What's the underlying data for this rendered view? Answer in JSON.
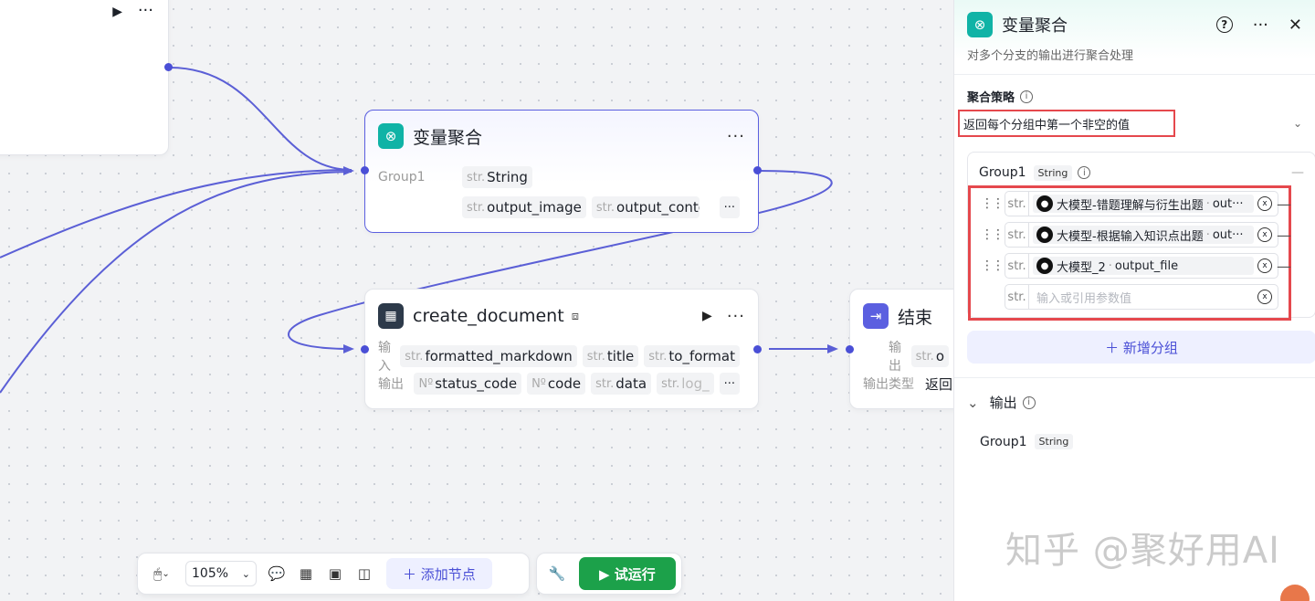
{
  "canvas": {
    "agg_node": {
      "title": "变量聚合",
      "more": "···",
      "group_label": "Group1",
      "type_chip": {
        "t": "str.",
        "v": "String"
      },
      "chips": [
        {
          "t": "str.",
          "v": "output_image"
        },
        {
          "t": "str.",
          "v": "output_conter"
        }
      ],
      "overflow": "···"
    },
    "doc_node": {
      "title": "create_document",
      "input_label": "输入",
      "output_label": "输出",
      "inputs": [
        {
          "t": "str.",
          "v": "formatted_markdown"
        },
        {
          "t": "str.",
          "v": "title"
        },
        {
          "t": "str.",
          "v": "to_format"
        }
      ],
      "outputs": [
        {
          "t": "Nº",
          "v": "status_code"
        },
        {
          "t": "Nº",
          "v": "code"
        },
        {
          "t": "str.",
          "v": "data"
        },
        {
          "t": "str.",
          "v": "log_"
        }
      ],
      "overflow": "···"
    },
    "end_node": {
      "title": "结束",
      "output_label": "输出",
      "output_chip_t": "str.",
      "output_chip_v": "o",
      "output_type_label": "输出类型",
      "output_type_value": "返回"
    }
  },
  "panel": {
    "title": "变量聚合",
    "help": "?",
    "more": "···",
    "close": "✕",
    "description": "对多个分支的输出进行聚合处理",
    "strategy_label": "聚合策略",
    "strategy_value": "返回每个分组中第一个非空的值",
    "group": {
      "name": "Group1",
      "type": "String",
      "vars": [
        {
          "t": "str.",
          "source": "大模型-错题理解与衍生出题",
          "field": "out···"
        },
        {
          "t": "str.",
          "source": "大模型-根据输入知识点出题",
          "field": "out···"
        },
        {
          "t": "str.",
          "source": "大模型_2",
          "field": "output_file"
        }
      ],
      "empty_t": "str.",
      "placeholder": "输入或引用参数值"
    },
    "add_group": "＋ 新增分组",
    "output_label": "输出",
    "output_group": "Group1",
    "output_type": "String",
    "watermark": "知乎 @聚好用AI"
  },
  "toolbar": {
    "zoom": "105%",
    "add_node": "＋ 添加节点",
    "run": "▶  试运行"
  }
}
